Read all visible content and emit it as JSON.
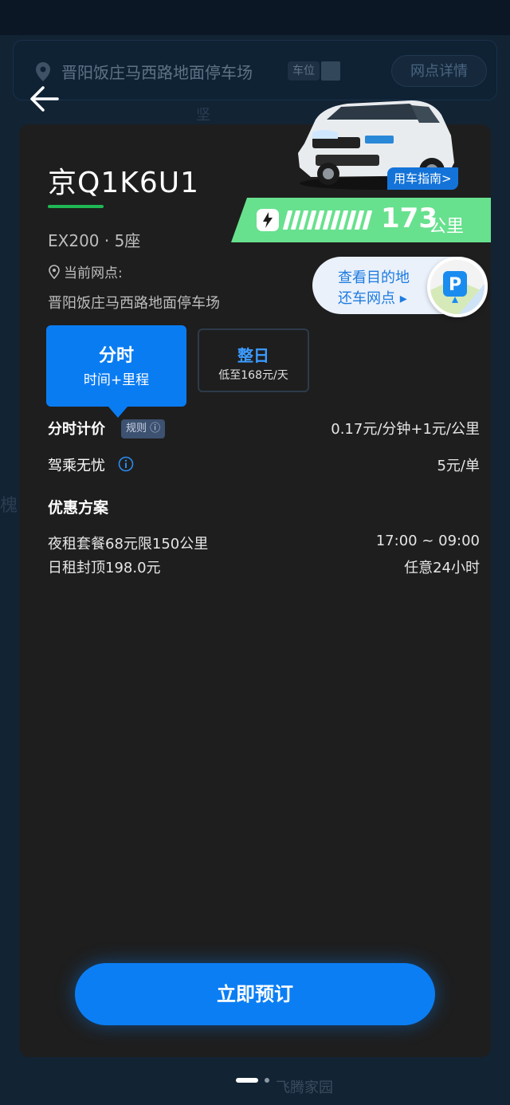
{
  "background": {
    "location_name": "晋阳饭庄马西路地面停车场",
    "location_tag": "车位",
    "detail_button": "网点详情",
    "map_texts": [
      "坚",
      "槐",
      "飞腾家园"
    ]
  },
  "car": {
    "plate": "京Q1K6U1",
    "model": "EX200 · 5座",
    "branch_label": "当前网点:",
    "branch_value": "晋阳饭庄马西路地面停车场",
    "guide_button": "用车指南>",
    "range_value": "173",
    "range_unit": "公里",
    "battery_level": 0.9
  },
  "destination": {
    "line1": "查看目的地",
    "line2": "还车网点 ▸",
    "icon": "parking-icon"
  },
  "tabs": [
    {
      "title": "分时",
      "subtitle": "时间+里程",
      "active": true
    },
    {
      "title": "整日",
      "subtitle": "低至168元/天",
      "active": false
    }
  ],
  "pricing": {
    "label": "分时计价",
    "rule_badge": "规则 ⓘ",
    "value": "0.17元/分钟+1元/公里"
  },
  "insurance": {
    "label": "驾乘无忧",
    "value": "5元/单"
  },
  "promotions": {
    "title": "优惠方案",
    "items": [
      {
        "name": "夜租套餐68元限150公里",
        "time": "17:00 ~ 09:00"
      },
      {
        "name": "日租封顶198.0元",
        "time": "任意24小时"
      }
    ]
  },
  "book_button": "立即预订",
  "colors": {
    "accent": "#0b7ef4",
    "battery": "#67e18e",
    "underline": "#1fb854",
    "card": "#1e1e1e"
  }
}
